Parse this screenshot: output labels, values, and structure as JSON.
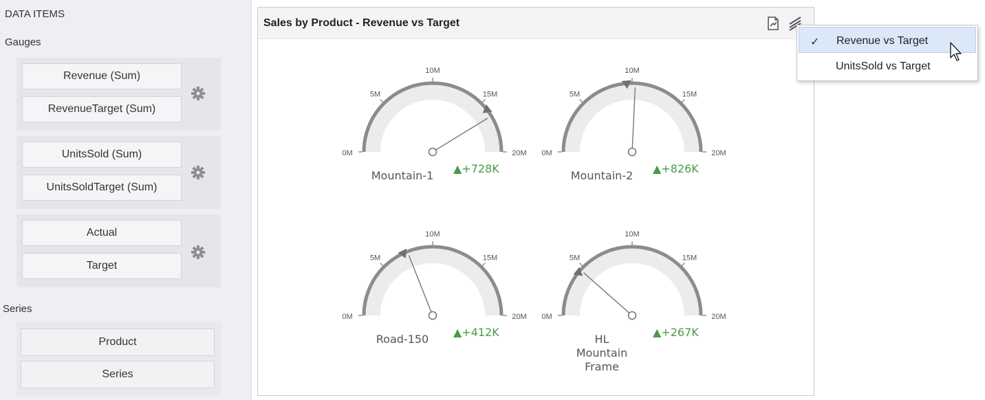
{
  "data_items": {
    "title": "DATA ITEMS",
    "gauges_label": "Gauges",
    "gauge_groups": [
      {
        "fields": [
          "Revenue (Sum)",
          "RevenueTarget (Sum)"
        ]
      },
      {
        "fields": [
          "UnitsSold (Sum)",
          "UnitsSoldTarget (Sum)"
        ]
      },
      {
        "fields": [
          "Actual",
          "Target"
        ]
      }
    ],
    "series_label": "Series",
    "series_fields": [
      "Product",
      "Series"
    ]
  },
  "dashboard_item": {
    "title": "Sales by Product - Revenue vs Target",
    "gauges": [
      {
        "name": "Mountain-1",
        "delta": "+728K",
        "target": 15.8,
        "actual": 16.5
      },
      {
        "name": "Mountain-2",
        "delta": "+826K",
        "target": 9.5,
        "actual": 10.3
      },
      {
        "name": "Road-150",
        "delta": "+412K",
        "target": 7.2,
        "actual": 7.6
      },
      {
        "name": "HL\nMountain\nFrame",
        "delta": "+267K",
        "target": 4.3,
        "actual": 4.6
      }
    ],
    "scale": {
      "min": 0,
      "max": 20,
      "ticks": [
        "0M",
        "5M",
        "10M",
        "15M",
        "20M"
      ]
    }
  },
  "menu": {
    "items": [
      {
        "label": "Revenue vs Target",
        "checked": true
      },
      {
        "label": "UnitsSold vs Target",
        "checked": false
      }
    ],
    "check_mark": "✓"
  },
  "colors": {
    "delta_up": "#4a9a46",
    "gauge_arc": "#8c8c8c",
    "gauge_fill": "#ececec",
    "needle": "#777777"
  }
}
